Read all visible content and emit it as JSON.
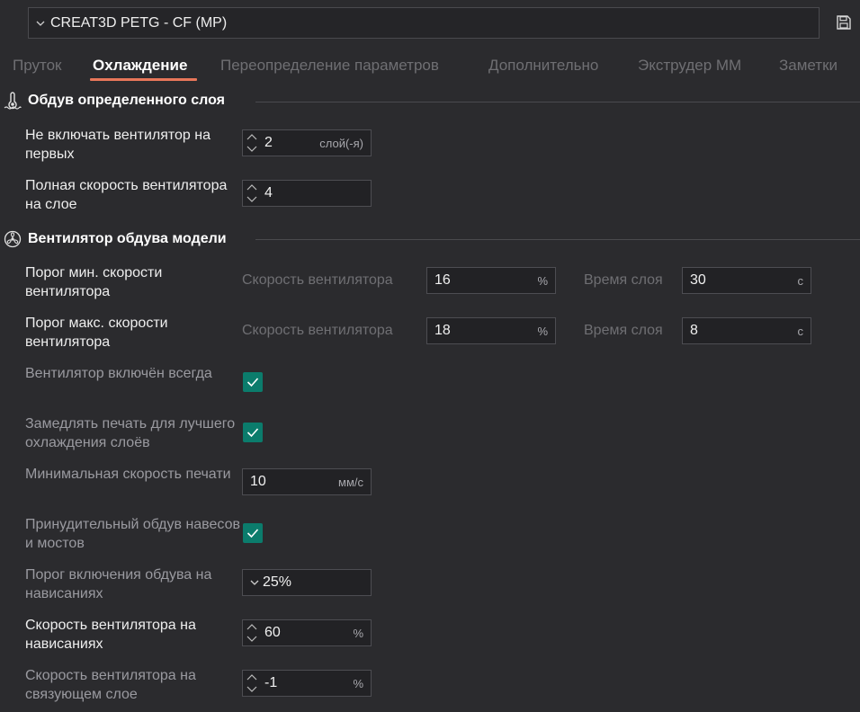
{
  "header": {
    "preset_name": "CREAT3D PETG - CF (MP)",
    "icons": {
      "dropdown": "chevron-down-icon",
      "save": "save-icon"
    }
  },
  "tabs": [
    {
      "label": "Пруток",
      "active": false
    },
    {
      "label": "Охлаждение",
      "active": true
    },
    {
      "label": "Переопределение параметров",
      "active": false
    },
    {
      "label": "Дополнительно",
      "active": false
    },
    {
      "label": "Экструдер ММ",
      "active": false
    },
    {
      "label": "Заметки",
      "active": false
    }
  ],
  "sections": {
    "layer_cooling": {
      "title": "Обдув определенного слоя",
      "icon": "layer-cooling-icon",
      "rows": {
        "disable_fan_first": {
          "label": "Не включать вентилятор на первых",
          "value": "2",
          "unit": "слой(-я)"
        },
        "full_fan_layer": {
          "label": "Полная скорость вентилятора на слое",
          "value": "4",
          "unit": ""
        }
      }
    },
    "part_fan": {
      "title": "Вентилятор обдува модели",
      "icon": "fan-icon",
      "rows": {
        "min_fan": {
          "label": "Порог мин. скорости вентилятора",
          "speed_label": "Скорость вентилятора",
          "speed_value": "16",
          "speed_unit": "%",
          "time_label": "Время слоя",
          "time_value": "30",
          "time_unit": "с"
        },
        "max_fan": {
          "label": "Порог макс. скорости вентилятора",
          "speed_label": "Скорость вентилятора",
          "speed_value": "18",
          "speed_unit": "%",
          "time_label": "Время слоя",
          "time_value": "8",
          "time_unit": "с"
        },
        "fan_always_on": {
          "label": "Вентилятор включён всегда",
          "checked": true
        },
        "slow_down": {
          "label": "Замедлять печать для лучшего охлаждения слоёв",
          "checked": true
        },
        "min_print_speed": {
          "label": "Минимальная скорость печати",
          "value": "10",
          "unit": "мм/с"
        },
        "force_bridge_cooling": {
          "label": "Принудительный обдув навесов и мостов",
          "checked": true
        },
        "overhang_threshold": {
          "label": "Порог включения обдува на нависаниях",
          "value": "25%"
        },
        "overhang_fan_speed": {
          "label": "Скорость вентилятора на нависаниях",
          "value": "60",
          "unit": "%"
        },
        "interface_fan_speed": {
          "label": "Скорость вентилятора на связующем слое",
          "value": "-1",
          "unit": "%"
        }
      }
    }
  },
  "colors": {
    "background": "#2b2b2e",
    "accent_underline": "#e8775a",
    "checkbox": "#0b7c6c"
  }
}
